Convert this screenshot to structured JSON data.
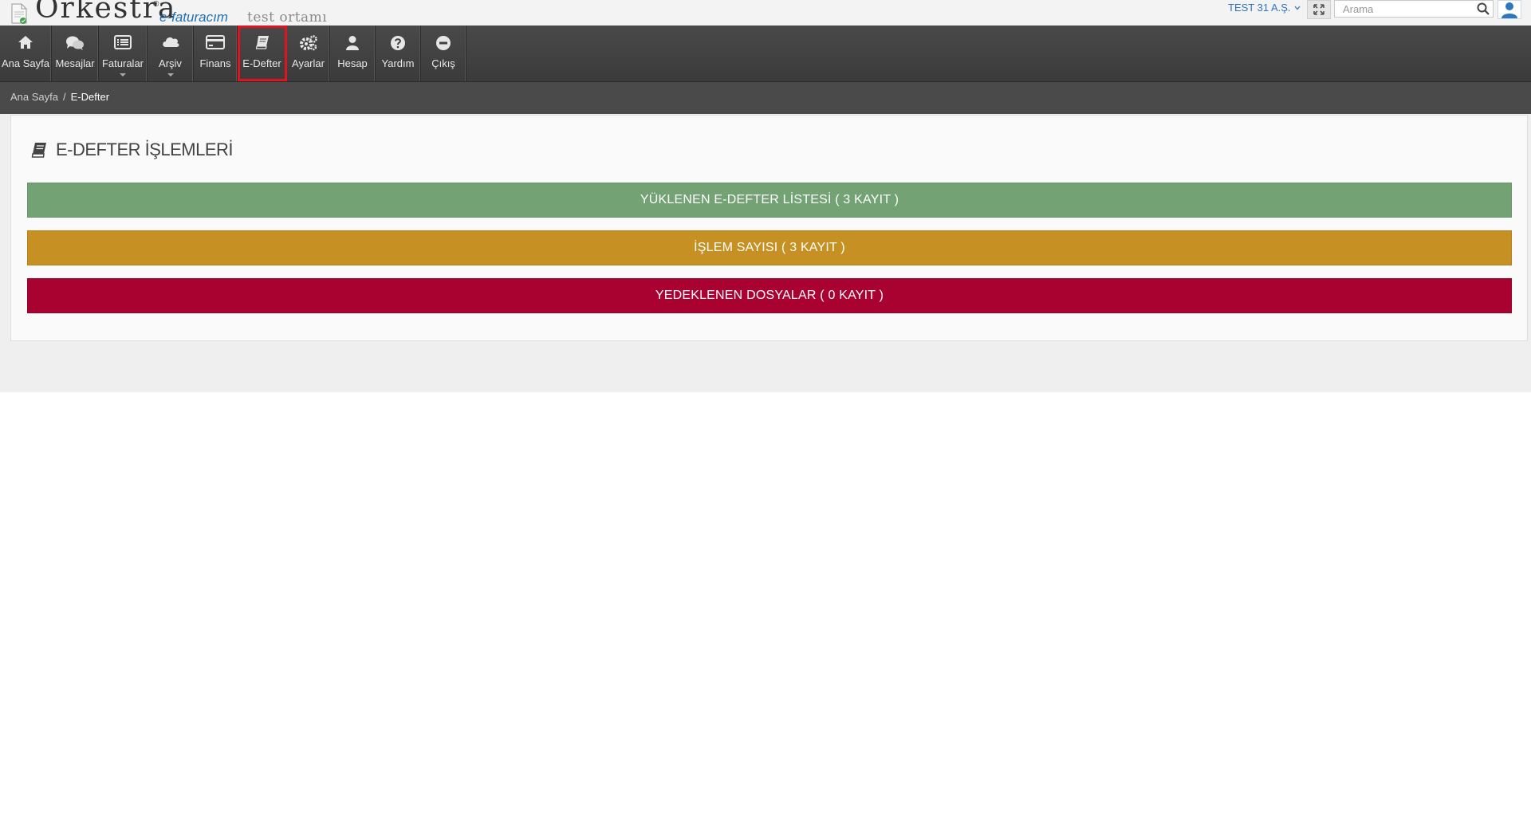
{
  "brand": {
    "name": "Orkestra",
    "registered": "®",
    "product": "e-faturacım",
    "environment": "test ortamı"
  },
  "topbar": {
    "company": "TEST 31 A.Ş.",
    "search_placeholder": "Arama"
  },
  "nav": {
    "items": [
      {
        "label": "Ana Sayfa",
        "icon": "home-icon"
      },
      {
        "label": "Mesajlar",
        "icon": "chat-icon"
      },
      {
        "label": "Faturalar",
        "icon": "list-icon",
        "dropdown": true
      },
      {
        "label": "Arşiv",
        "icon": "cloud-icon",
        "dropdown": true
      },
      {
        "label": "Finans",
        "icon": "credit-card-icon"
      },
      {
        "label": "E-Defter",
        "icon": "book-icon",
        "active": true
      },
      {
        "label": "Ayarlar",
        "icon": "gears-icon"
      },
      {
        "label": "Hesap",
        "icon": "user-icon"
      },
      {
        "label": "Yardım",
        "icon": "question-icon"
      },
      {
        "label": "Çıkış",
        "icon": "minus-circle-icon"
      }
    ]
  },
  "breadcrumb": {
    "home": "Ana Sayfa",
    "separator": "/",
    "current": "E-Defter"
  },
  "panel": {
    "title": "E-DEFTER İŞLEMLERİ",
    "bars": [
      {
        "label": "YÜKLENEN E-DEFTER LİSTESİ ( 3 KAYIT )",
        "color": "#73a275"
      },
      {
        "label": "İŞLEM SAYISI ( 3 KAYIT )",
        "color": "#c69022"
      },
      {
        "label": "YEDEKLENEN DOSYALAR ( 0 KAYIT )",
        "color": "#aa0230"
      }
    ]
  },
  "colors": {
    "nav_bg": "#3f3f3f",
    "active_outline": "#e0141e",
    "link_blue": "#2f76c0"
  }
}
